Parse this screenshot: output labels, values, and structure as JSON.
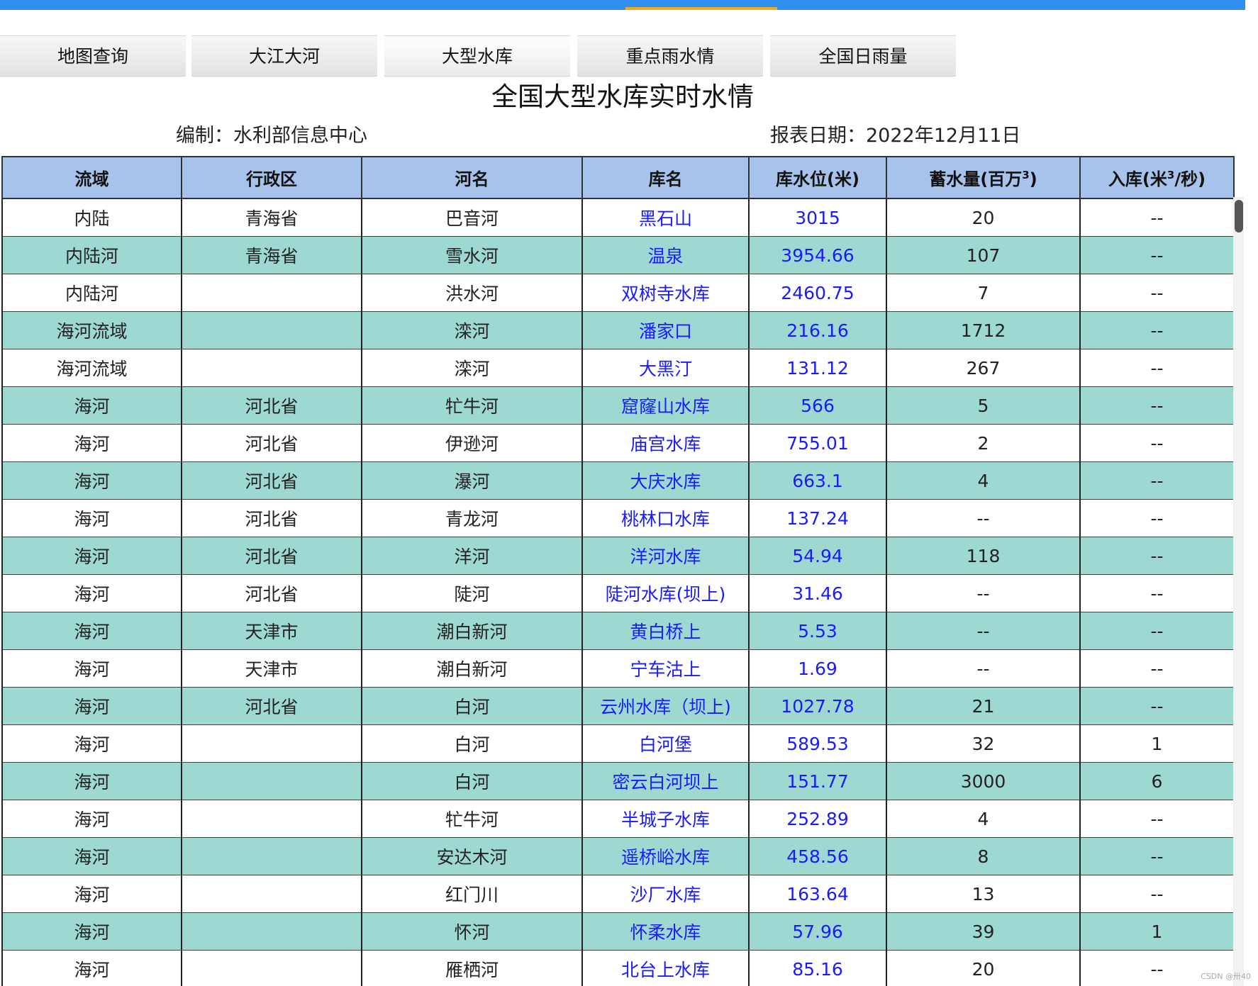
{
  "nav": {
    "tabs": [
      {
        "label": "地图查询"
      },
      {
        "label": "大江大河"
      },
      {
        "label": "大型水库"
      },
      {
        "label": "重点雨水情"
      },
      {
        "label": "全国日雨量"
      }
    ],
    "active": "大型水库"
  },
  "report": {
    "title": "全国大型水库实时水情",
    "compiler": "编制：水利部信息中心",
    "date": "报表日期：2022年12月11日"
  },
  "table": {
    "headers": {
      "basin": "流域",
      "region": "行政区",
      "river": "河名",
      "reservoir": "库名",
      "water_level": "库水位(米)",
      "storage_prefix": "蓄水量(百万",
      "storage_sup": "3",
      "storage_suffix": ")",
      "inflow_prefix": "入库(米",
      "inflow_sup": "3",
      "inflow_suffix": "/秒)"
    },
    "rows": [
      {
        "basin": "内陆",
        "region": "青海省",
        "river": "巴音河",
        "reservoir": "黑石山",
        "level": "3015",
        "storage": "20",
        "inflow": "--"
      },
      {
        "basin": "内陆河",
        "region": "青海省",
        "river": "雪水河",
        "reservoir": "温泉",
        "level": "3954.66",
        "storage": "107",
        "inflow": "--"
      },
      {
        "basin": "内陆河",
        "region": "",
        "river": "洪水河",
        "reservoir": "双树寺水库",
        "level": "2460.75",
        "storage": "7",
        "inflow": "--"
      },
      {
        "basin": "海河流域",
        "region": "",
        "river": "滦河",
        "reservoir": "潘家口",
        "level": "216.16",
        "storage": "1712",
        "inflow": "--"
      },
      {
        "basin": "海河流域",
        "region": "",
        "river": "滦河",
        "reservoir": "大黑汀",
        "level": "131.12",
        "storage": "267",
        "inflow": "--"
      },
      {
        "basin": "海河",
        "region": "河北省",
        "river": "牤牛河",
        "reservoir": "窟窿山水库",
        "level": "566",
        "storage": "5",
        "inflow": "--"
      },
      {
        "basin": "海河",
        "region": "河北省",
        "river": "伊逊河",
        "reservoir": "庙宫水库",
        "level": "755.01",
        "storage": "2",
        "inflow": "--"
      },
      {
        "basin": "海河",
        "region": "河北省",
        "river": "瀑河",
        "reservoir": "大庆水库",
        "level": "663.1",
        "storage": "4",
        "inflow": "--"
      },
      {
        "basin": "海河",
        "region": "河北省",
        "river": "青龙河",
        "reservoir": "桃林口水库",
        "level": "137.24",
        "storage": "--",
        "inflow": "--"
      },
      {
        "basin": "海河",
        "region": "河北省",
        "river": "洋河",
        "reservoir": "洋河水库",
        "level": "54.94",
        "storage": "118",
        "inflow": "--"
      },
      {
        "basin": "海河",
        "region": "河北省",
        "river": "陡河",
        "reservoir": "陡河水库(坝上)",
        "level": "31.46",
        "storage": "--",
        "inflow": "--"
      },
      {
        "basin": "海河",
        "region": "天津市",
        "river": "潮白新河",
        "reservoir": "黄白桥上",
        "level": "5.53",
        "storage": "--",
        "inflow": "--"
      },
      {
        "basin": "海河",
        "region": "天津市",
        "river": "潮白新河",
        "reservoir": "宁车沽上",
        "level": "1.69",
        "storage": "--",
        "inflow": "--"
      },
      {
        "basin": "海河",
        "region": "河北省",
        "river": "白河",
        "reservoir": "云州水库（坝上)",
        "level": "1027.78",
        "storage": "21",
        "inflow": "--"
      },
      {
        "basin": "海河",
        "region": "",
        "river": "白河",
        "reservoir": "白河堡",
        "level": "589.53",
        "storage": "32",
        "inflow": "1"
      },
      {
        "basin": "海河",
        "region": "",
        "river": "白河",
        "reservoir": "密云白河坝上",
        "level": "151.77",
        "storage": "3000",
        "inflow": "6"
      },
      {
        "basin": "海河",
        "region": "",
        "river": "牤牛河",
        "reservoir": "半城子水库",
        "level": "252.89",
        "storage": "4",
        "inflow": "--"
      },
      {
        "basin": "海河",
        "region": "",
        "river": "安达木河",
        "reservoir": "遥桥峪水库",
        "level": "458.56",
        "storage": "8",
        "inflow": "--"
      },
      {
        "basin": "海河",
        "region": "",
        "river": "红门川",
        "reservoir": "沙厂水库",
        "level": "163.64",
        "storage": "13",
        "inflow": "--"
      },
      {
        "basin": "海河",
        "region": "",
        "river": "怀河",
        "reservoir": "怀柔水库",
        "level": "57.96",
        "storage": "39",
        "inflow": "1"
      },
      {
        "basin": "海河",
        "region": "",
        "river": "雁栖河",
        "reservoir": "北台上水库",
        "level": "85.16",
        "storage": "20",
        "inflow": "--"
      }
    ]
  },
  "footer": {
    "watermark": "CSDN @卅40"
  },
  "colors": {
    "topbar": "#2f8ff0",
    "topbar_accent": "#f5a623",
    "header_bg": "#a7c2eb",
    "row_alt_bg": "#9dd9d0",
    "link": "#1a1aff"
  }
}
